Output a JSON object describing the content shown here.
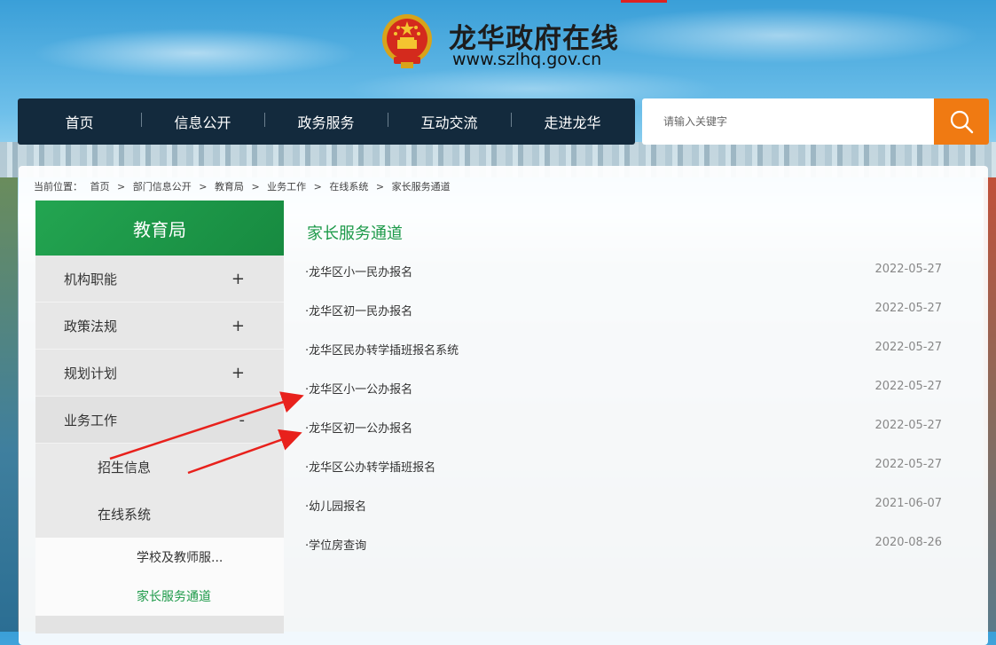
{
  "header": {
    "site_title": "龙华政府在线",
    "site_url": "www.szlhq.gov.cn"
  },
  "nav": {
    "items": [
      "首页",
      "信息公开",
      "政务服务",
      "互动交流",
      "走进龙华"
    ]
  },
  "search": {
    "placeholder": "请输入关键字"
  },
  "breadcrumb": {
    "prefix": "当前位置：",
    "items": [
      "首页",
      "部门信息公开",
      "教育局",
      "业务工作",
      "在线系统",
      "家长服务通道"
    ],
    "separator": ">"
  },
  "sidebar": {
    "title": "教育局",
    "items": [
      {
        "label": "机构职能",
        "symbol": "+"
      },
      {
        "label": "政策法规",
        "symbol": "+"
      },
      {
        "label": "规划计划",
        "symbol": "+"
      },
      {
        "label": "业务工作",
        "symbol": "-"
      }
    ],
    "sub_items": [
      "招生信息",
      "在线系统"
    ],
    "sub_sub_items": [
      "学校及教师服...",
      "家长服务通道"
    ]
  },
  "content": {
    "title": "家长服务通道",
    "list": [
      {
        "title": "·龙华区小一民办报名",
        "date": "2022-05-27"
      },
      {
        "title": "·龙华区初一民办报名",
        "date": "2022-05-27"
      },
      {
        "title": "·龙华区民办转学插班报名系统",
        "date": "2022-05-27"
      },
      {
        "title": "·龙华区小一公办报名",
        "date": "2022-05-27"
      },
      {
        "title": "·龙华区初一公办报名",
        "date": "2022-05-27"
      },
      {
        "title": "·龙华区公办转学插班报名",
        "date": "2022-05-27"
      },
      {
        "title": "·幼儿园报名",
        "date": "2021-06-07"
      },
      {
        "title": "·学位房查询",
        "date": "2020-08-26"
      }
    ]
  },
  "colors": {
    "nav_bg": "#132a3d",
    "accent_green": "#1e9a4a",
    "search_button": "#f07a12",
    "annotation_arrow": "#e8211c"
  },
  "icons": {
    "emblem": "national-emblem-icon",
    "search": "search-icon"
  }
}
